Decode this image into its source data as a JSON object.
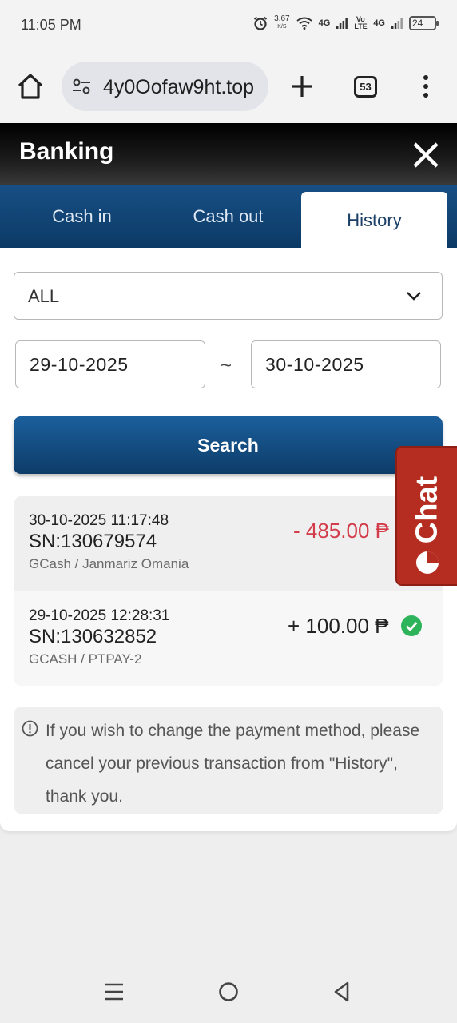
{
  "status_bar": {
    "time": "11:05 PM",
    "net_speed": "3.67",
    "net_speed_unit": "K/S",
    "net1": "4G",
    "volte": "Vo LTE",
    "net2": "4G",
    "battery": "24"
  },
  "browser": {
    "url": "4y0Oofaw9ht.top",
    "tab_count": "53"
  },
  "banking": {
    "title": "Banking",
    "tabs": [
      {
        "label": "Cash in",
        "active": false
      },
      {
        "label": "Cash out",
        "active": false
      },
      {
        "label": "History",
        "active": true
      }
    ],
    "filter": {
      "selected": "ALL"
    },
    "date_from": "29-10-2025",
    "date_separator": "~",
    "date_to": "30-10-2025",
    "search_label": "Search",
    "transactions": [
      {
        "datetime": "30-10-2025 11:17:48",
        "sn": "SN:130679574",
        "method": "GCash / Janmariz Omania",
        "amount": "- 485.00 ₱",
        "status": "cancelled",
        "color": "#d33c4a"
      },
      {
        "datetime": "29-10-2025 12:28:31",
        "sn": "SN:130632852",
        "method": "GCASH / PTPAY-2",
        "amount": "+ 100.00 ₱",
        "status": "success",
        "color": "#222222"
      }
    ],
    "notice": "If you wish to change the payment method, please cancel your previous transaction from \"History\", thank you."
  },
  "chat": {
    "label": "Chat",
    "color": "#b52d20"
  },
  "colors": {
    "tab_bar": "#0c3a66",
    "success": "#2db35a",
    "negative": "#d33c4a"
  }
}
